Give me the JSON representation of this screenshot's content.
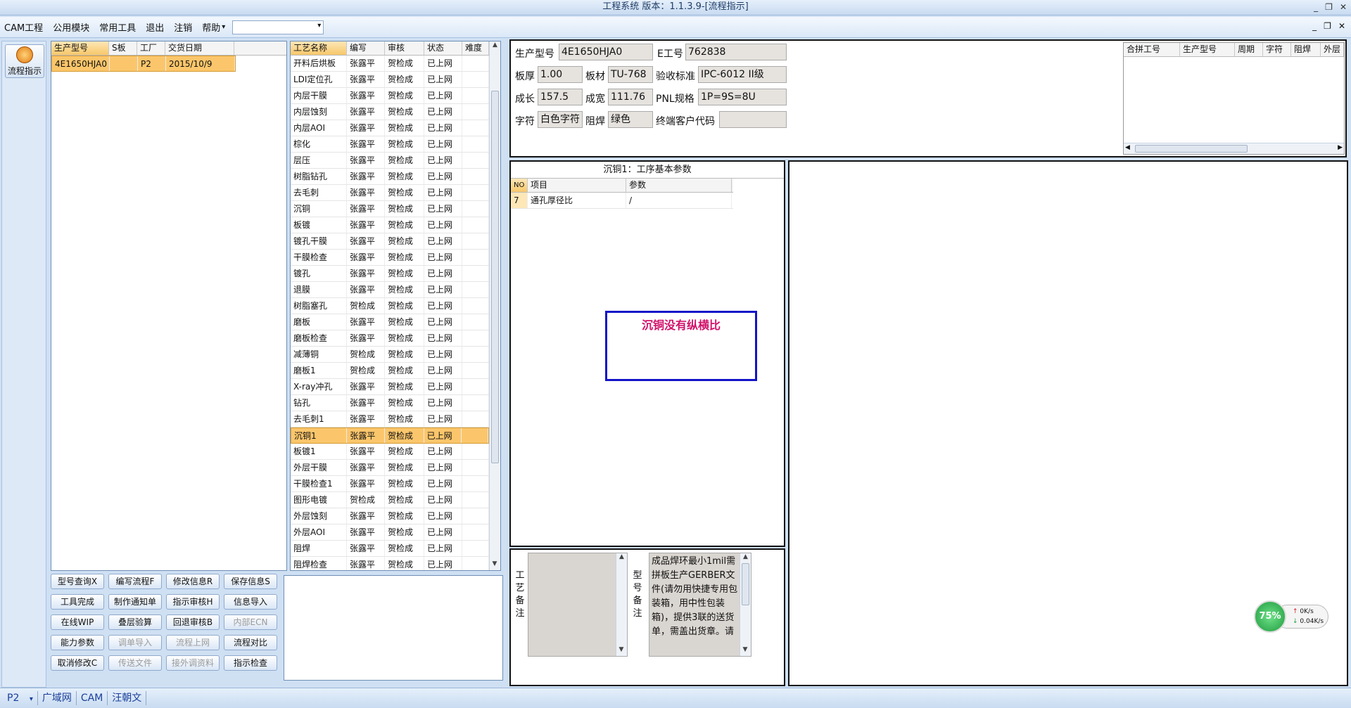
{
  "window": {
    "title": "工程系统 版本：1.1.3.9-[流程指示]",
    "controls": [
      "_",
      "❐",
      "✕"
    ],
    "mdi_controls": [
      "_",
      "❐",
      "✕"
    ]
  },
  "menu": {
    "items": [
      "CAM工程",
      "公用模块",
      "常用工具",
      "退出",
      "注销",
      "帮助"
    ],
    "help_arrow": "▾",
    "combo_value": ""
  },
  "sidebar": {
    "flow_button": "流程指示"
  },
  "orders": {
    "headers": [
      "生产型号",
      "S板",
      "工厂",
      "交货日期"
    ],
    "rows": [
      {
        "model": "4E1650HJA0",
        "s": "",
        "factory": "P2",
        "date": "2015/10/9"
      }
    ]
  },
  "process": {
    "headers": [
      "工艺名称",
      "编写",
      "审核",
      "状态",
      "难度"
    ],
    "rows": [
      [
        "开料后烘板",
        "张露平",
        "贺检成",
        "已上网",
        ""
      ],
      [
        "LDI定位孔",
        "张露平",
        "贺检成",
        "已上网",
        ""
      ],
      [
        "内层干膜",
        "张露平",
        "贺检成",
        "已上网",
        ""
      ],
      [
        "内层蚀刻",
        "张露平",
        "贺检成",
        "已上网",
        ""
      ],
      [
        "内层AOI",
        "张露平",
        "贺检成",
        "已上网",
        ""
      ],
      [
        "棕化",
        "张露平",
        "贺检成",
        "已上网",
        ""
      ],
      [
        "层压",
        "张露平",
        "贺检成",
        "已上网",
        ""
      ],
      [
        "树脂钻孔",
        "张露平",
        "贺检成",
        "已上网",
        ""
      ],
      [
        "去毛刺",
        "张露平",
        "贺检成",
        "已上网",
        ""
      ],
      [
        "沉铜",
        "张露平",
        "贺检成",
        "已上网",
        ""
      ],
      [
        "板镀",
        "张露平",
        "贺检成",
        "已上网",
        ""
      ],
      [
        "镀孔干膜",
        "张露平",
        "贺检成",
        "已上网",
        ""
      ],
      [
        "干膜检查",
        "张露平",
        "贺检成",
        "已上网",
        ""
      ],
      [
        "镀孔",
        "张露平",
        "贺检成",
        "已上网",
        ""
      ],
      [
        "退膜",
        "张露平",
        "贺检成",
        "已上网",
        ""
      ],
      [
        "树脂塞孔",
        "贺检成",
        "贺检成",
        "已上网",
        ""
      ],
      [
        "磨板",
        "张露平",
        "贺检成",
        "已上网",
        ""
      ],
      [
        "磨板检查",
        "张露平",
        "贺检成",
        "已上网",
        ""
      ],
      [
        "减薄铜",
        "贺检成",
        "贺检成",
        "已上网",
        ""
      ],
      [
        "磨板1",
        "贺检成",
        "贺检成",
        "已上网",
        ""
      ],
      [
        "X-ray冲孔",
        "张露平",
        "贺检成",
        "已上网",
        ""
      ],
      [
        "钻孔",
        "张露平",
        "贺检成",
        "已上网",
        ""
      ],
      [
        "去毛刺1",
        "张露平",
        "贺检成",
        "已上网",
        ""
      ],
      [
        "沉铜1",
        "张露平",
        "贺检成",
        "已上网",
        ""
      ],
      [
        "板镀1",
        "张露平",
        "贺检成",
        "已上网",
        ""
      ],
      [
        "外层干膜",
        "张露平",
        "贺检成",
        "已上网",
        ""
      ],
      [
        "干膜检查1",
        "张露平",
        "贺检成",
        "已上网",
        ""
      ],
      [
        "图形电镀",
        "贺检成",
        "贺检成",
        "已上网",
        ""
      ],
      [
        "外层蚀刻",
        "张露平",
        "贺检成",
        "已上网",
        ""
      ],
      [
        "外层AOI",
        "张露平",
        "贺检成",
        "已上网",
        ""
      ],
      [
        "阻焊",
        "张露平",
        "贺检成",
        "已上网",
        ""
      ],
      [
        "阻焊检查",
        "张露平",
        "贺检成",
        "已上网",
        ""
      ]
    ],
    "selected_index": 23
  },
  "buttons": [
    {
      "label": "型号查询X",
      "enabled": true
    },
    {
      "label": "编写流程F",
      "enabled": true
    },
    {
      "label": "修改信息R",
      "enabled": true
    },
    {
      "label": "保存信息S",
      "enabled": true
    },
    {
      "label": "工具完成",
      "enabled": true
    },
    {
      "label": "制作通知单",
      "enabled": true
    },
    {
      "label": "指示审核H",
      "enabled": true
    },
    {
      "label": "信息导入",
      "enabled": true
    },
    {
      "label": "在线WIP",
      "enabled": true
    },
    {
      "label": "叠层验算",
      "enabled": true
    },
    {
      "label": "回退审核B",
      "enabled": true
    },
    {
      "label": "内部ECN",
      "enabled": false
    },
    {
      "label": "能力参数",
      "enabled": true
    },
    {
      "label": "调单导入",
      "enabled": false
    },
    {
      "label": "流程上网",
      "enabled": false
    },
    {
      "label": "流程对比",
      "enabled": true
    },
    {
      "label": "取消修改C",
      "enabled": true
    },
    {
      "label": "传送文件",
      "enabled": false
    },
    {
      "label": "接外调资料",
      "enabled": false
    },
    {
      "label": "指示检查",
      "enabled": true
    }
  ],
  "info": {
    "model_label": "生产型号",
    "model_value": "4E1650HJA0",
    "eno_label": "E工号",
    "eno_value": "762838",
    "thickness_label": "板厚",
    "thickness_value": "1.00",
    "material_label": "板材",
    "material_value": "TU-768",
    "standard_label": "验收标准",
    "standard_value": "IPC-6012 II级",
    "length_label": "成长",
    "length_value": "157.5",
    "width_label": "成宽",
    "width_value": "111.76",
    "pnl_label": "PNL规格",
    "pnl_value": "1P=9S=8U",
    "char_label": "字符",
    "char_value": "白色字符",
    "mask_label": "阻焊",
    "mask_value": "绿色",
    "customer_label": "终端客户代码",
    "customer_value": ""
  },
  "merge": {
    "headers": [
      "合拼工号",
      "生产型号",
      "周期",
      "字符",
      "阻焊",
      "外层"
    ]
  },
  "params": {
    "title": "沉铜1：工序基本参数",
    "headers": [
      "NO",
      "项目",
      "参数"
    ],
    "rows": [
      {
        "no": "7",
        "item": "通孔厚径比",
        "value": "/"
      }
    ],
    "alert": "沉铜没有纵横比"
  },
  "remarks": {
    "process_label": "工艺备注",
    "model_label": "型号备注",
    "process_text": "",
    "model_text": "成品焊环最小1mil需拼板生产GERBER文件(请勿用快捷专用包装箱，用中性包装箱)，提供3联的送货单，需盖出货章。请"
  },
  "status": {
    "factory": "P2",
    "arrow": "▾",
    "network": "广域网",
    "dept": "CAM",
    "user": "汪朝文"
  },
  "net": {
    "percent": "75%",
    "up": "0K/s",
    "down": "0.04K/s"
  }
}
